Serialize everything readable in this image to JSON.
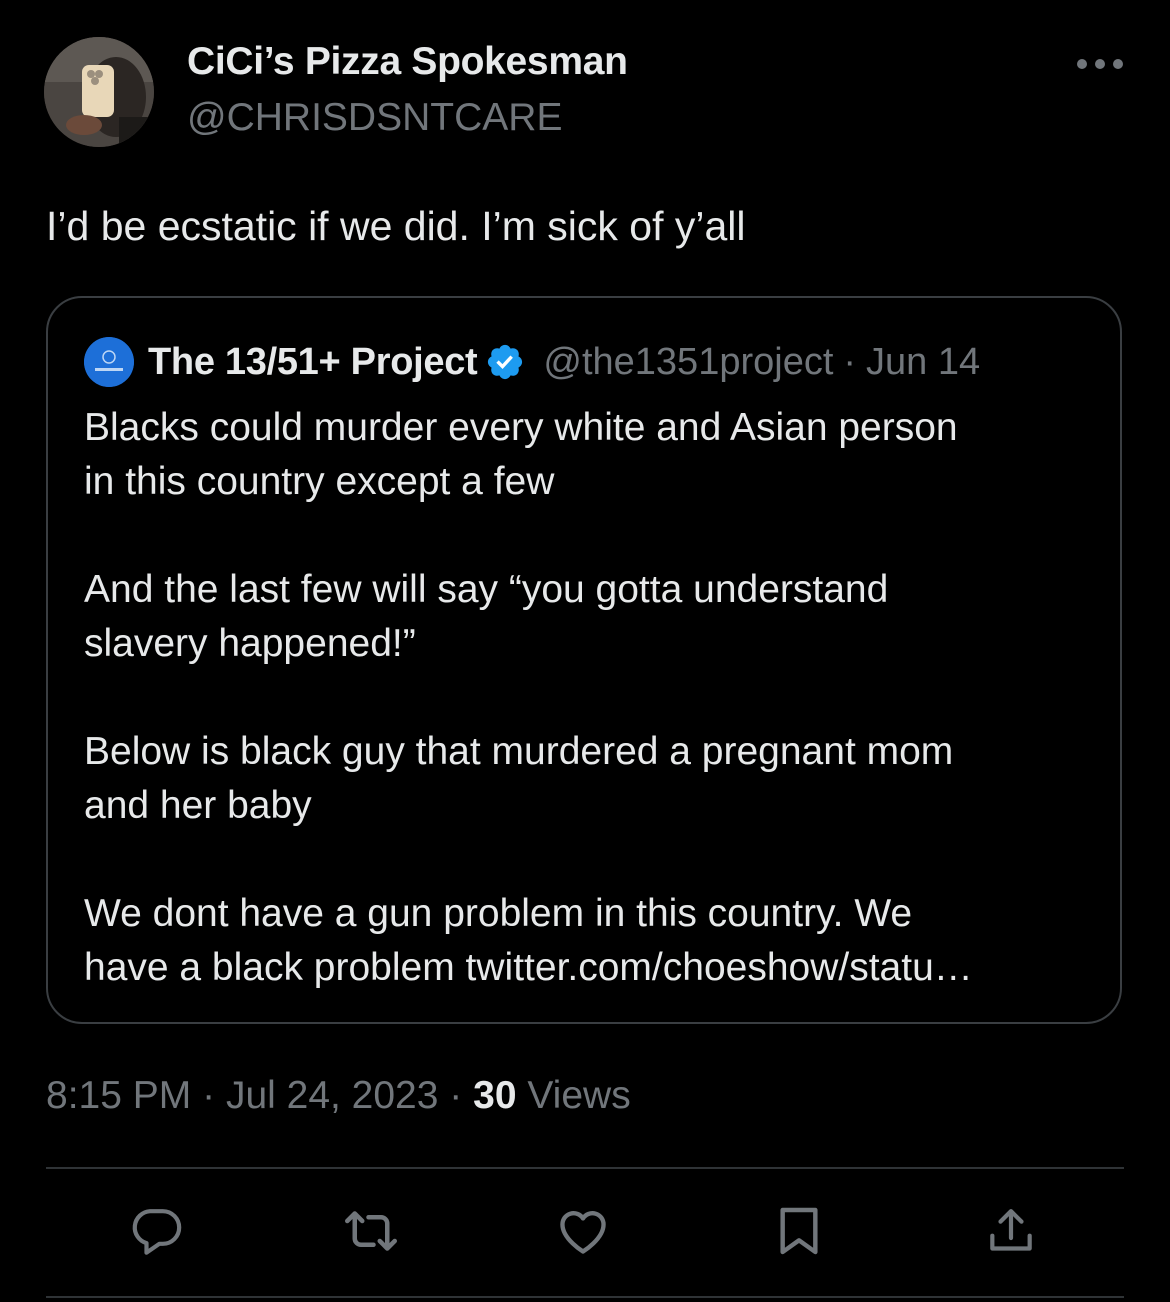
{
  "author": {
    "display_name": "CiCi’s Pizza Spokesman",
    "handle": "@CHRISDSNTCARE"
  },
  "tweet": {
    "text": "I’d be ecstatic if we did. I’m sick of y’all"
  },
  "quoted_tweet": {
    "display_name": "The 13/51+ Project",
    "handle": "@the1351project",
    "separator": "·",
    "date": "Jun 14",
    "paragraphs": [
      "Blacks could murder every white and Asian person",
      "in this country except a few",
      "And the last few will say “you gotta understand",
      "slavery happened!”",
      "Below is black guy that murdered a pregnant mom",
      "and her baby",
      "We dont have a gun problem in this country. We",
      "have a black problem twitter.com/choeshow/statu…"
    ]
  },
  "meta": {
    "time": "8:15 PM",
    "separator": "·",
    "date": "Jul 24, 2023",
    "views_count": "30",
    "views_label": "Views"
  },
  "actions": [
    "reply-icon",
    "retweet-icon",
    "like-icon",
    "bookmark-icon",
    "share-icon"
  ],
  "colors": {
    "background": "#000000",
    "text_primary": "#e7e9ea",
    "text_secondary": "#71767b",
    "border": "#3a3e42",
    "divider": "#2f3336",
    "verified": "#1d9bf0"
  }
}
